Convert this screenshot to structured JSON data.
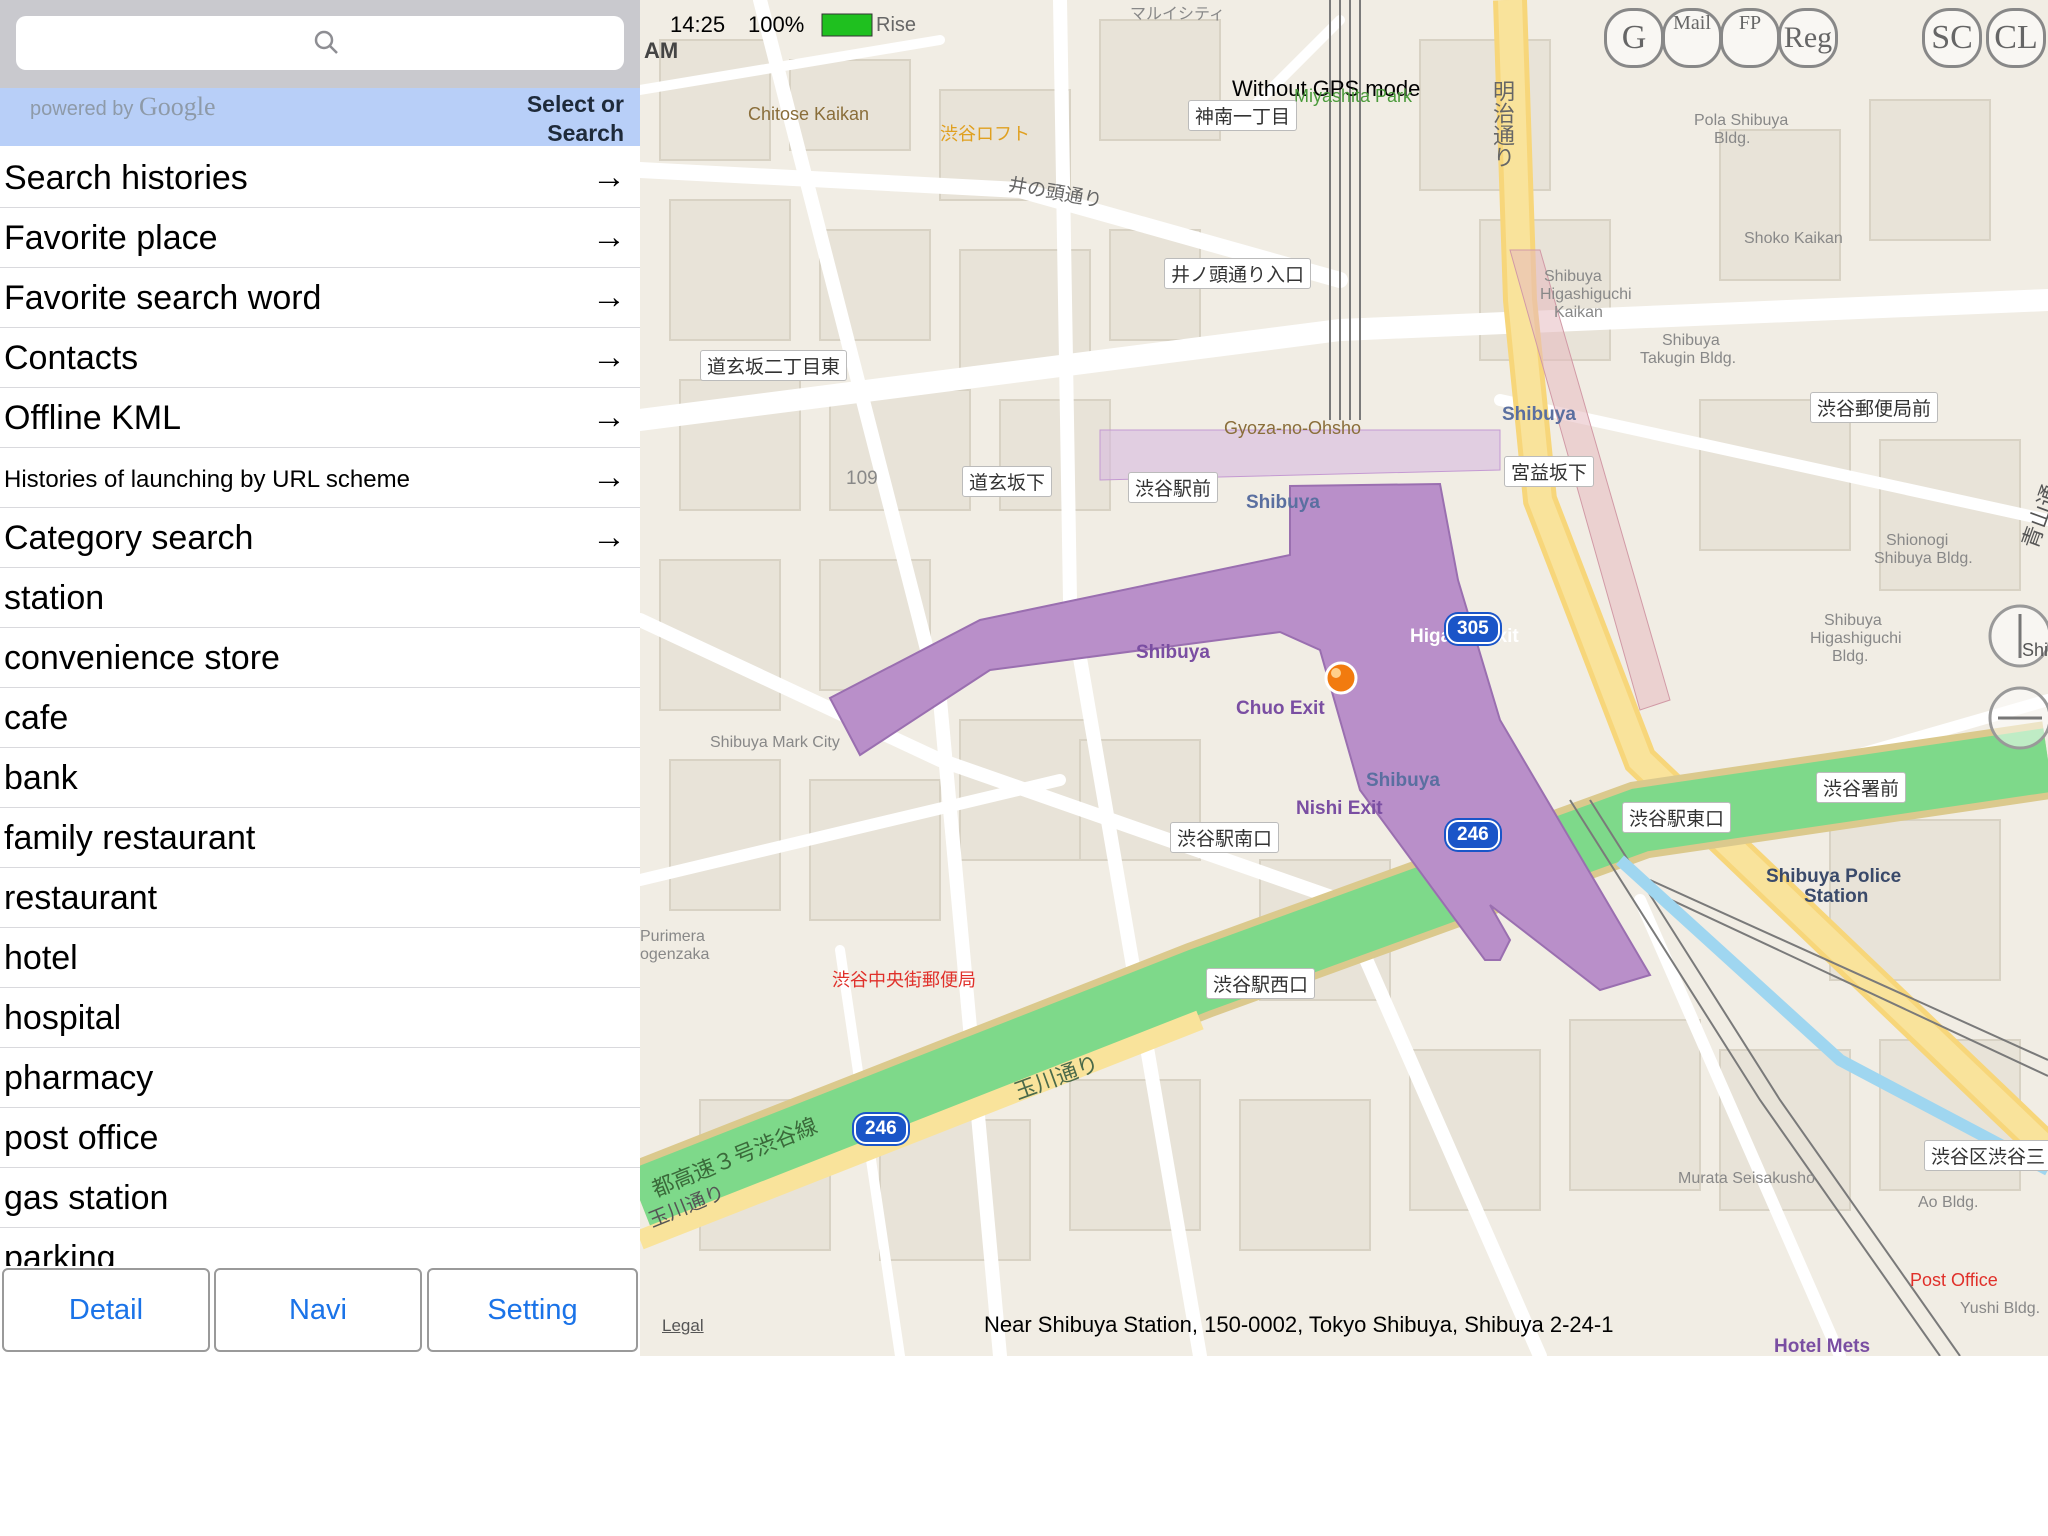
{
  "search": {
    "placeholder": ""
  },
  "google_strip": {
    "powered": "powered by",
    "brand": "Google",
    "select_line1": "Select or",
    "select_line2": "Search"
  },
  "list": [
    {
      "label": "Search histories",
      "arrow": "→"
    },
    {
      "label": "Favorite place",
      "arrow": "→"
    },
    {
      "label": "Favorite search word",
      "arrow": "→"
    },
    {
      "label": "Contacts",
      "arrow": "→"
    },
    {
      "label": "Offline KML",
      "arrow": "→"
    },
    {
      "label": "Histories of launching by URL scheme",
      "arrow": "→"
    },
    {
      "label": "Category search",
      "arrow": "→"
    },
    {
      "label": "station"
    },
    {
      "label": "convenience store"
    },
    {
      "label": "cafe"
    },
    {
      "label": "bank"
    },
    {
      "label": "family restaurant"
    },
    {
      "label": "restaurant"
    },
    {
      "label": "hotel"
    },
    {
      "label": "hospital"
    },
    {
      "label": "pharmacy"
    },
    {
      "label": "post office"
    },
    {
      "label": "gas station"
    },
    {
      "label": "parking"
    }
  ],
  "bottom": {
    "detail": "Detail",
    "navi": "Navi",
    "setting": "Setting"
  },
  "status": {
    "time": "14:25",
    "battery": "100%",
    "am": "AM",
    "rise": "Rise"
  },
  "map": {
    "mode": "Without GPS mode",
    "legal": "Legal",
    "address": "Near Shibuya Station, 150-0002, Tokyo Shibuya, Shibuya 2-24-1",
    "top_buttons": [
      "G",
      "Mail",
      "FP",
      "Reg",
      "SC",
      "CL"
    ],
    "labels": {
      "chitose": "Chitose Kaikan",
      "loft": "渋谷ロフト",
      "miyashita": "Miyashita Park",
      "jinnan": "神南一丁目",
      "inokashira": "井の頭通り",
      "inokashira_iriguchi": "井ノ頭通り入口",
      "dogen2": "道玄坂二丁目東",
      "gyoza": "Gyoza-no-Ohsho",
      "shibuya_ekimae": "渋谷駅前",
      "dogenzaka_shita": "道玄坂下",
      "shibuya1": "Shibuya",
      "shibuya2": "Shibuya",
      "shibuya3": "Shibuya",
      "shibuya4": "Shibuya",
      "miyamasuzaka": "宮益坂下",
      "yubinkyoku": "渋谷郵便局前",
      "higashi_exit": "Higashi Exit",
      "chuo_exit": "Chuo Exit",
      "nishi_exit": "Nishi Exit",
      "minamiguchi": "渋谷駅南口",
      "higashiguchi": "渋谷駅東口",
      "nishiguchi": "渋谷駅西口",
      "keisatsu": "渋谷署前",
      "police": "Shibuya Police",
      "police2": "Station",
      "post_chuo": "渋谷中央街郵便局",
      "tamagawa": "玉川通り",
      "shuto3": "都高速３号渋谷線",
      "tamagawa2": "玉川通り",
      "markcity": "Shibuya Mark City",
      "purimera": "Purimera",
      "ogenzaka": "ogenzaka",
      "murata": "Murata Seisakusho",
      "ao": "Ao Bldg.",
      "yushi": "Yushi Bldg.",
      "post_office": "Post Office",
      "hotel_mets": "Hotel Mets",
      "shibuya3chome": "渋谷区渋谷三",
      "shoko": "Shoko Kaikan",
      "pola": "Pola Shibuya",
      "pola2": "Bldg.",
      "meiji": "明治通り",
      "aoyama": "青山通",
      "shionogi": "Shionogi",
      "shionogi2": "Shibuya Bldg.",
      "takugin": "Shibuya",
      "takugin2": "Takugin Bldg.",
      "hhk": "Shibuya",
      "hhk2": "Higashiguchi",
      "hhk3": "Kaikan",
      "hhb": "Shibuya",
      "hhb2": "Higashiguchi",
      "hhb3": "Bldg.",
      "n109": "109",
      "shi": "Shi",
      "marui": "マルイシティ",
      "r246a": "246",
      "r246b": "246",
      "r305": "305"
    }
  }
}
